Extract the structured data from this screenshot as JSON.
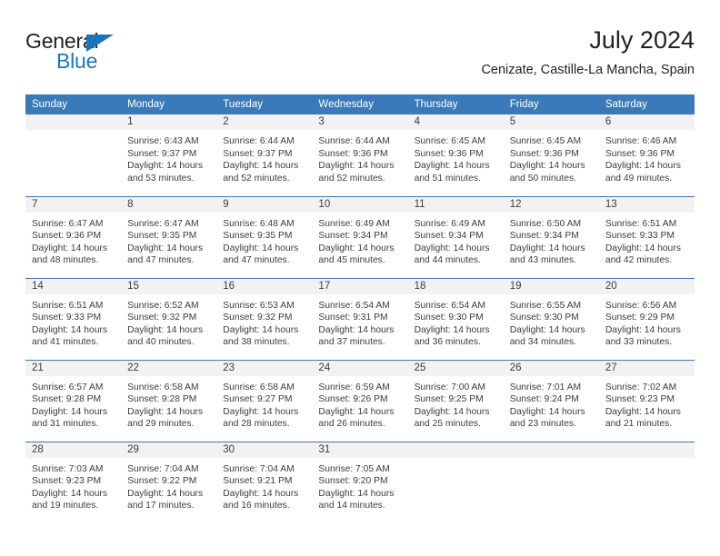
{
  "brand": {
    "name_primary": "General",
    "name_secondary": "Blue",
    "accent_color": "#1b75bc"
  },
  "header": {
    "title": "July 2024",
    "subtitle": "Cenizate, Castille-La Mancha, Spain"
  },
  "theme": {
    "header_blue": "#3a7ab8",
    "daynum_band": "#f2f2f2",
    "text": "#3c3c3c"
  },
  "weekday_headers": [
    "Sunday",
    "Monday",
    "Tuesday",
    "Wednesday",
    "Thursday",
    "Friday",
    "Saturday"
  ],
  "weeks": [
    [
      {
        "day": "",
        "blank": true,
        "sunrise": "",
        "sunset": "",
        "daylight_line1": "",
        "daylight_line2": ""
      },
      {
        "day": "1",
        "blank": false,
        "sunrise": "Sunrise: 6:43 AM",
        "sunset": "Sunset: 9:37 PM",
        "daylight_line1": "Daylight: 14 hours",
        "daylight_line2": "and 53 minutes."
      },
      {
        "day": "2",
        "blank": false,
        "sunrise": "Sunrise: 6:44 AM",
        "sunset": "Sunset: 9:37 PM",
        "daylight_line1": "Daylight: 14 hours",
        "daylight_line2": "and 52 minutes."
      },
      {
        "day": "3",
        "blank": false,
        "sunrise": "Sunrise: 6:44 AM",
        "sunset": "Sunset: 9:36 PM",
        "daylight_line1": "Daylight: 14 hours",
        "daylight_line2": "and 52 minutes."
      },
      {
        "day": "4",
        "blank": false,
        "sunrise": "Sunrise: 6:45 AM",
        "sunset": "Sunset: 9:36 PM",
        "daylight_line1": "Daylight: 14 hours",
        "daylight_line2": "and 51 minutes."
      },
      {
        "day": "5",
        "blank": false,
        "sunrise": "Sunrise: 6:45 AM",
        "sunset": "Sunset: 9:36 PM",
        "daylight_line1": "Daylight: 14 hours",
        "daylight_line2": "and 50 minutes."
      },
      {
        "day": "6",
        "blank": false,
        "sunrise": "Sunrise: 6:46 AM",
        "sunset": "Sunset: 9:36 PM",
        "daylight_line1": "Daylight: 14 hours",
        "daylight_line2": "and 49 minutes."
      }
    ],
    [
      {
        "day": "7",
        "blank": false,
        "sunrise": "Sunrise: 6:47 AM",
        "sunset": "Sunset: 9:36 PM",
        "daylight_line1": "Daylight: 14 hours",
        "daylight_line2": "and 48 minutes."
      },
      {
        "day": "8",
        "blank": false,
        "sunrise": "Sunrise: 6:47 AM",
        "sunset": "Sunset: 9:35 PM",
        "daylight_line1": "Daylight: 14 hours",
        "daylight_line2": "and 47 minutes."
      },
      {
        "day": "9",
        "blank": false,
        "sunrise": "Sunrise: 6:48 AM",
        "sunset": "Sunset: 9:35 PM",
        "daylight_line1": "Daylight: 14 hours",
        "daylight_line2": "and 47 minutes."
      },
      {
        "day": "10",
        "blank": false,
        "sunrise": "Sunrise: 6:49 AM",
        "sunset": "Sunset: 9:34 PM",
        "daylight_line1": "Daylight: 14 hours",
        "daylight_line2": "and 45 minutes."
      },
      {
        "day": "11",
        "blank": false,
        "sunrise": "Sunrise: 6:49 AM",
        "sunset": "Sunset: 9:34 PM",
        "daylight_line1": "Daylight: 14 hours",
        "daylight_line2": "and 44 minutes."
      },
      {
        "day": "12",
        "blank": false,
        "sunrise": "Sunrise: 6:50 AM",
        "sunset": "Sunset: 9:34 PM",
        "daylight_line1": "Daylight: 14 hours",
        "daylight_line2": "and 43 minutes."
      },
      {
        "day": "13",
        "blank": false,
        "sunrise": "Sunrise: 6:51 AM",
        "sunset": "Sunset: 9:33 PM",
        "daylight_line1": "Daylight: 14 hours",
        "daylight_line2": "and 42 minutes."
      }
    ],
    [
      {
        "day": "14",
        "blank": false,
        "sunrise": "Sunrise: 6:51 AM",
        "sunset": "Sunset: 9:33 PM",
        "daylight_line1": "Daylight: 14 hours",
        "daylight_line2": "and 41 minutes."
      },
      {
        "day": "15",
        "blank": false,
        "sunrise": "Sunrise: 6:52 AM",
        "sunset": "Sunset: 9:32 PM",
        "daylight_line1": "Daylight: 14 hours",
        "daylight_line2": "and 40 minutes."
      },
      {
        "day": "16",
        "blank": false,
        "sunrise": "Sunrise: 6:53 AM",
        "sunset": "Sunset: 9:32 PM",
        "daylight_line1": "Daylight: 14 hours",
        "daylight_line2": "and 38 minutes."
      },
      {
        "day": "17",
        "blank": false,
        "sunrise": "Sunrise: 6:54 AM",
        "sunset": "Sunset: 9:31 PM",
        "daylight_line1": "Daylight: 14 hours",
        "daylight_line2": "and 37 minutes."
      },
      {
        "day": "18",
        "blank": false,
        "sunrise": "Sunrise: 6:54 AM",
        "sunset": "Sunset: 9:30 PM",
        "daylight_line1": "Daylight: 14 hours",
        "daylight_line2": "and 36 minutes."
      },
      {
        "day": "19",
        "blank": false,
        "sunrise": "Sunrise: 6:55 AM",
        "sunset": "Sunset: 9:30 PM",
        "daylight_line1": "Daylight: 14 hours",
        "daylight_line2": "and 34 minutes."
      },
      {
        "day": "20",
        "blank": false,
        "sunrise": "Sunrise: 6:56 AM",
        "sunset": "Sunset: 9:29 PM",
        "daylight_line1": "Daylight: 14 hours",
        "daylight_line2": "and 33 minutes."
      }
    ],
    [
      {
        "day": "21",
        "blank": false,
        "sunrise": "Sunrise: 6:57 AM",
        "sunset": "Sunset: 9:28 PM",
        "daylight_line1": "Daylight: 14 hours",
        "daylight_line2": "and 31 minutes."
      },
      {
        "day": "22",
        "blank": false,
        "sunrise": "Sunrise: 6:58 AM",
        "sunset": "Sunset: 9:28 PM",
        "daylight_line1": "Daylight: 14 hours",
        "daylight_line2": "and 29 minutes."
      },
      {
        "day": "23",
        "blank": false,
        "sunrise": "Sunrise: 6:58 AM",
        "sunset": "Sunset: 9:27 PM",
        "daylight_line1": "Daylight: 14 hours",
        "daylight_line2": "and 28 minutes."
      },
      {
        "day": "24",
        "blank": false,
        "sunrise": "Sunrise: 6:59 AM",
        "sunset": "Sunset: 9:26 PM",
        "daylight_line1": "Daylight: 14 hours",
        "daylight_line2": "and 26 minutes."
      },
      {
        "day": "25",
        "blank": false,
        "sunrise": "Sunrise: 7:00 AM",
        "sunset": "Sunset: 9:25 PM",
        "daylight_line1": "Daylight: 14 hours",
        "daylight_line2": "and 25 minutes."
      },
      {
        "day": "26",
        "blank": false,
        "sunrise": "Sunrise: 7:01 AM",
        "sunset": "Sunset: 9:24 PM",
        "daylight_line1": "Daylight: 14 hours",
        "daylight_line2": "and 23 minutes."
      },
      {
        "day": "27",
        "blank": false,
        "sunrise": "Sunrise: 7:02 AM",
        "sunset": "Sunset: 9:23 PM",
        "daylight_line1": "Daylight: 14 hours",
        "daylight_line2": "and 21 minutes."
      }
    ],
    [
      {
        "day": "28",
        "blank": false,
        "sunrise": "Sunrise: 7:03 AM",
        "sunset": "Sunset: 9:23 PM",
        "daylight_line1": "Daylight: 14 hours",
        "daylight_line2": "and 19 minutes."
      },
      {
        "day": "29",
        "blank": false,
        "sunrise": "Sunrise: 7:04 AM",
        "sunset": "Sunset: 9:22 PM",
        "daylight_line1": "Daylight: 14 hours",
        "daylight_line2": "and 17 minutes."
      },
      {
        "day": "30",
        "blank": false,
        "sunrise": "Sunrise: 7:04 AM",
        "sunset": "Sunset: 9:21 PM",
        "daylight_line1": "Daylight: 14 hours",
        "daylight_line2": "and 16 minutes."
      },
      {
        "day": "31",
        "blank": false,
        "sunrise": "Sunrise: 7:05 AM",
        "sunset": "Sunset: 9:20 PM",
        "daylight_line1": "Daylight: 14 hours",
        "daylight_line2": "and 14 minutes."
      },
      {
        "day": "",
        "blank": true,
        "sunrise": "",
        "sunset": "",
        "daylight_line1": "",
        "daylight_line2": ""
      },
      {
        "day": "",
        "blank": true,
        "sunrise": "",
        "sunset": "",
        "daylight_line1": "",
        "daylight_line2": ""
      },
      {
        "day": "",
        "blank": true,
        "sunrise": "",
        "sunset": "",
        "daylight_line1": "",
        "daylight_line2": ""
      }
    ]
  ]
}
